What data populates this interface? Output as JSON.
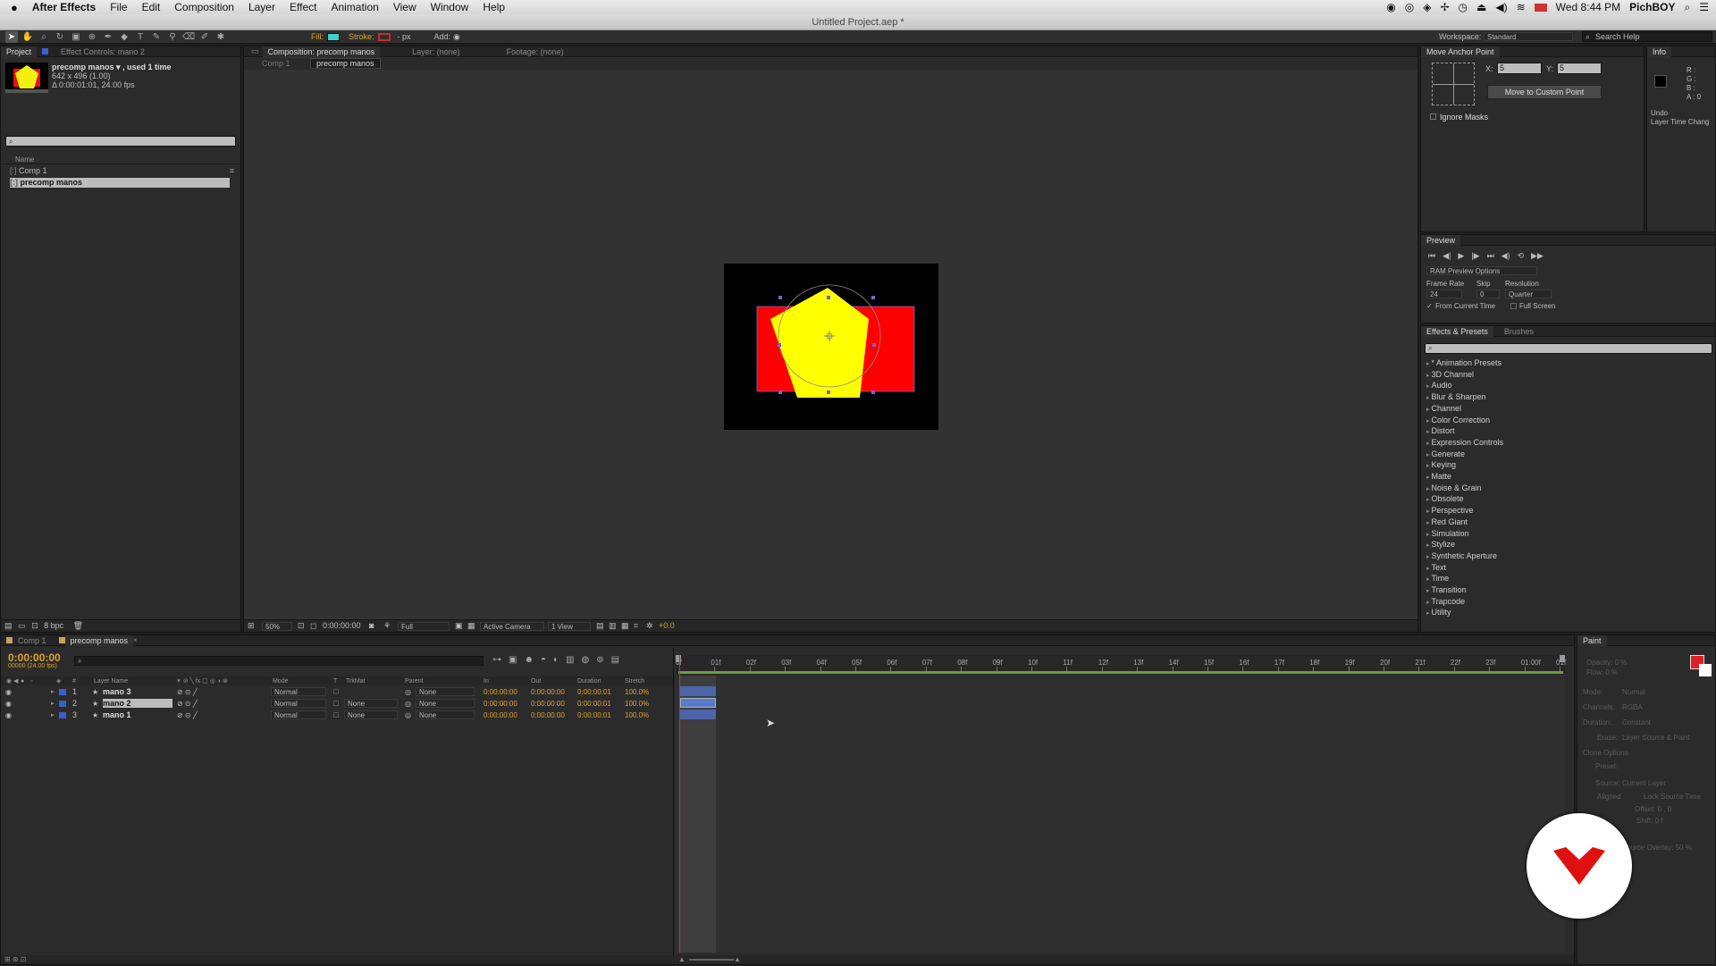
{
  "menubar": {
    "app_name": "After Effects",
    "items": [
      "File",
      "Edit",
      "Composition",
      "Layer",
      "Effect",
      "Animation",
      "View",
      "Window",
      "Help"
    ],
    "clock": "Wed 8:44 PM",
    "user": "PichBOY"
  },
  "window": {
    "title": "Untitled Project.aep *"
  },
  "toolbar": {
    "fill_label": "Fill:",
    "fill_color": "#3fd0c8",
    "stroke_label": "Stroke:",
    "stroke_color": "#c03030",
    "px_label": "- px",
    "add_label": "Add:",
    "workspace_label": "Workspace:",
    "workspace_value": "Standard",
    "search_placeholder": "Search Help"
  },
  "project_panel": {
    "tabs": [
      "Project",
      "Effect Controls: mano 2"
    ],
    "item_name": "precomp manos ▾ , used 1 time",
    "item_size": "642 x 496 (1.00)",
    "item_duration": "Δ 0:00:01:01, 24.00 fps",
    "search_placeholder": "",
    "column_name": "Name",
    "items": [
      {
        "name": "Comp 1",
        "selected": false
      },
      {
        "name": "precomp manos",
        "selected": true
      }
    ],
    "footer_bpc": "8 bpc"
  },
  "composition_panel": {
    "tabs": [
      "Composition: precomp manos",
      "Layer: (none)",
      "Footage: (none)"
    ],
    "breadcrumbs": [
      "Comp 1",
      "precomp manos"
    ],
    "zoom": "50%",
    "timecode": "0:00:00:00",
    "resolution": "Full",
    "camera": "Active Camera",
    "view": "1 View",
    "exposure": "+0.0"
  },
  "move_anchor_panel": {
    "title": "Move Anchor Point",
    "x_label": "X:",
    "x_value": "5",
    "y_label": "Y:",
    "y_value": "5",
    "button": "Move to Custom Point",
    "ignore_masks": "Ignore Masks"
  },
  "info_panel": {
    "title": "Info",
    "r": "R :",
    "g": "G :",
    "b": "B :",
    "a": "A : 0",
    "undo_label": "Undo",
    "undo_value": "Layer Time Chang"
  },
  "preview_panel": {
    "title": "Preview",
    "ram_options": "RAM Preview Options",
    "frame_rate_label": "Frame Rate",
    "frame_rate": "24",
    "skip_label": "Skip",
    "skip": "0",
    "resolution_label": "Resolution",
    "resolution": "Quarter",
    "from_current": "From Current Time",
    "full_screen": "Full Screen"
  },
  "effects_panel": {
    "tabs": [
      "Effects & Presets",
      "Brushes"
    ],
    "items": [
      "* Animation Presets",
      "3D Channel",
      "Audio",
      "Blur & Sharpen",
      "Channel",
      "Color Correction",
      "Distort",
      "Expression Controls",
      "Generate",
      "Keying",
      "Matte",
      "Noise & Grain",
      "Obsolete",
      "Perspective",
      "Red Giant",
      "Simulation",
      "Stylize",
      "Synthetic Aperture",
      "Text",
      "Time",
      "Transition",
      "Trapcode",
      "Utility"
    ]
  },
  "timeline": {
    "tabs": [
      "Comp 1",
      "precomp manos"
    ],
    "current_time": "0:00:00:00",
    "fps_label": "00000 (24.00 fps)",
    "columns": {
      "layer_name": "Layer Name",
      "mode": "Mode",
      "t": "T",
      "trkmat": "TrkMat",
      "parent": "Parent",
      "in": "In",
      "out": "Out",
      "duration": "Duration",
      "stretch": "Stretch"
    },
    "layers": [
      {
        "num": "1",
        "name": "mano 3",
        "mode": "Normal",
        "trkmat": "",
        "parent": "None",
        "in": "0:00:00:00",
        "out": "0:00:00:00",
        "duration": "0:00:00:01",
        "stretch": "100.0%",
        "selected": false
      },
      {
        "num": "2",
        "name": "mano 2",
        "mode": "Normal",
        "trkmat": "None",
        "parent": "None",
        "in": "0:00:00:00",
        "out": "0:00:00:00",
        "duration": "0:00:00:01",
        "stretch": "100.0%",
        "selected": true
      },
      {
        "num": "3",
        "name": "mano 1",
        "mode": "Normal",
        "trkmat": "None",
        "parent": "None",
        "in": "0:00:00:00",
        "out": "0:00:00:00",
        "duration": "0:00:00:01",
        "stretch": "100.0%",
        "selected": false
      }
    ],
    "ruler": [
      "0f",
      "01f",
      "02f",
      "03f",
      "04f",
      "05f",
      "06f",
      "07f",
      "08f",
      "09f",
      "10f",
      "11f",
      "12f",
      "13f",
      "14f",
      "15f",
      "16f",
      "17f",
      "18f",
      "19f",
      "20f",
      "21f",
      "22f",
      "23f",
      "01:00f",
      "01f"
    ]
  },
  "paint_panel": {
    "title": "Paint",
    "opacity": "Opacity: 0 %",
    "flow": "Flow: 0 %",
    "mode_label": "Mode:",
    "mode": "Normal",
    "channels_label": "Channels:",
    "channels": "RGBA",
    "duration_label": "Duration:",
    "duration": "Constant",
    "erase_label": "Erase:",
    "erase": "Layer Source & Paint",
    "clone_options": "Clone Options",
    "preset_label": "Preset:",
    "source_label": "Source:",
    "source": "Current Layer",
    "aligned": "Aligned",
    "lock_source": "Lock Source Time",
    "offset": "Offset: 0 ,    0",
    "shift": "Shift: 0 f",
    "overlay": "Source Overlay: 50 %",
    "fg_color": "#e02020"
  }
}
